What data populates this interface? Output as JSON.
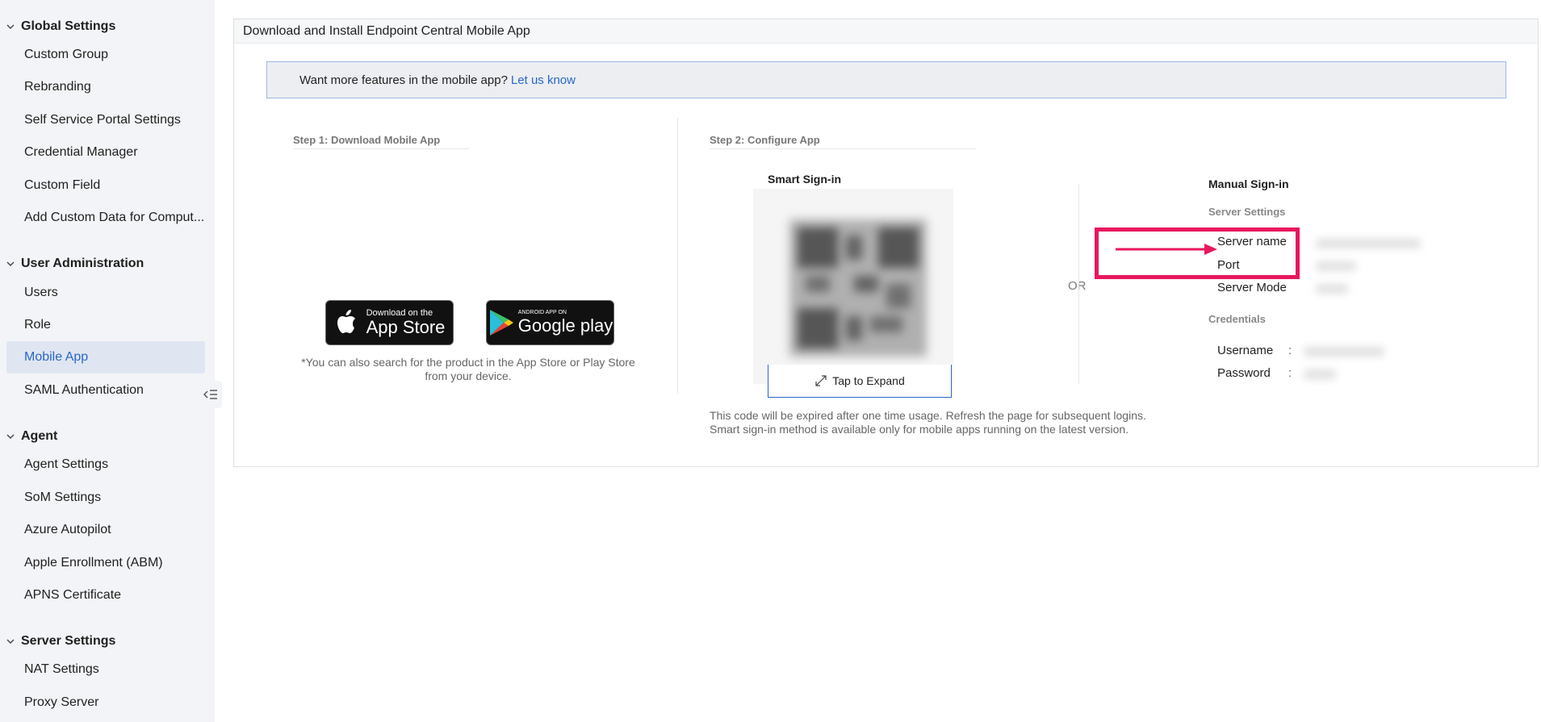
{
  "sidebar": {
    "groups": [
      {
        "label": "Global Settings",
        "items": [
          "Custom Group",
          "Rebranding",
          "Self Service Portal Settings",
          "Credential Manager",
          "Custom Field",
          "Add Custom Data for Comput..."
        ]
      },
      {
        "label": "User Administration",
        "items": [
          "Users",
          "Role",
          "Mobile App",
          "SAML Authentication"
        ]
      },
      {
        "label": "Agent",
        "items": [
          "Agent Settings",
          "SoM Settings",
          "Azure Autopilot",
          "Apple Enrollment (ABM)",
          "APNS Certificate"
        ]
      },
      {
        "label": "Server Settings",
        "items": [
          "NAT Settings",
          "Proxy Server"
        ]
      }
    ],
    "active_item": "Mobile App"
  },
  "panel": {
    "title": "Download and Install Endpoint Central Mobile App",
    "banner_text": "Want more features in the mobile app?",
    "banner_link": "Let us know"
  },
  "step1": {
    "title": "Step 1: Download Mobile App",
    "app_store_small": "Download on the",
    "app_store_big": "App Store",
    "google_small": "ANDROID APP ON",
    "google_big": "Google play",
    "note_line1": "*You can also search for the product in the App Store or Play Store",
    "note_line2": "from your device."
  },
  "step2": {
    "title": "Step 2: Configure App",
    "smart_title": "Smart Sign-in",
    "expand_label": "Tap to Expand",
    "or_label": "OR",
    "note_line1": "This code will be expired after one time usage. Refresh the page for subsequent logins.",
    "note_line2": "Smart sign-in method is available only for mobile apps running on the latest version.",
    "manual_title": "Manual Sign-in",
    "server_settings_label": "Server Settings",
    "server_name_label": "Server name",
    "port_label": "Port",
    "server_mode_label": "Server Mode",
    "credentials_label": "Credentials",
    "username_label": "Username",
    "password_label": "Password",
    "colon": ":"
  },
  "colors": {
    "accent": "#2a66c9",
    "highlight": "#e8175d",
    "sidebar_bg": "#f3f4f7",
    "active_bg": "#dfe6f2"
  }
}
